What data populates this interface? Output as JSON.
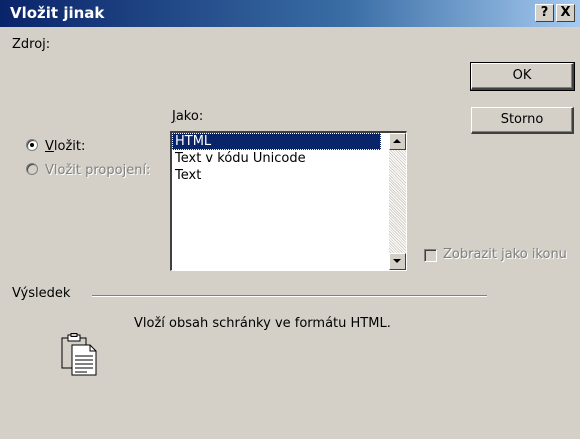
{
  "window": {
    "title": "Vložit jinak",
    "help_button": "?",
    "close_button": "X"
  },
  "source": {
    "label": "Zdroj:"
  },
  "as_group": {
    "label_prefix": "",
    "label_accel": "J",
    "label_rest": "ako:",
    "items": [
      "HTML",
      "Text v kódu Unicode",
      "Text"
    ],
    "selected_index": 0
  },
  "radios": {
    "paste": {
      "accel": "V",
      "rest": "ložit:",
      "checked": true
    },
    "paste_link": {
      "label": "Vložit propojení:",
      "checked": false,
      "disabled": true
    }
  },
  "buttons": {
    "ok": "OK",
    "cancel": "Storno"
  },
  "display_as_icon": {
    "label": "Zobrazit jako ikonu",
    "checked": false,
    "disabled": true
  },
  "result": {
    "title": "Výsledek",
    "description": "Vloží obsah schránky ve formátu HTML.",
    "icon": "clipboard-icon"
  },
  "colors": {
    "titlebar_start": "#0a246a",
    "titlebar_end": "#a6caf0",
    "face": "#d4d0c8",
    "selection": "#0a246a"
  }
}
